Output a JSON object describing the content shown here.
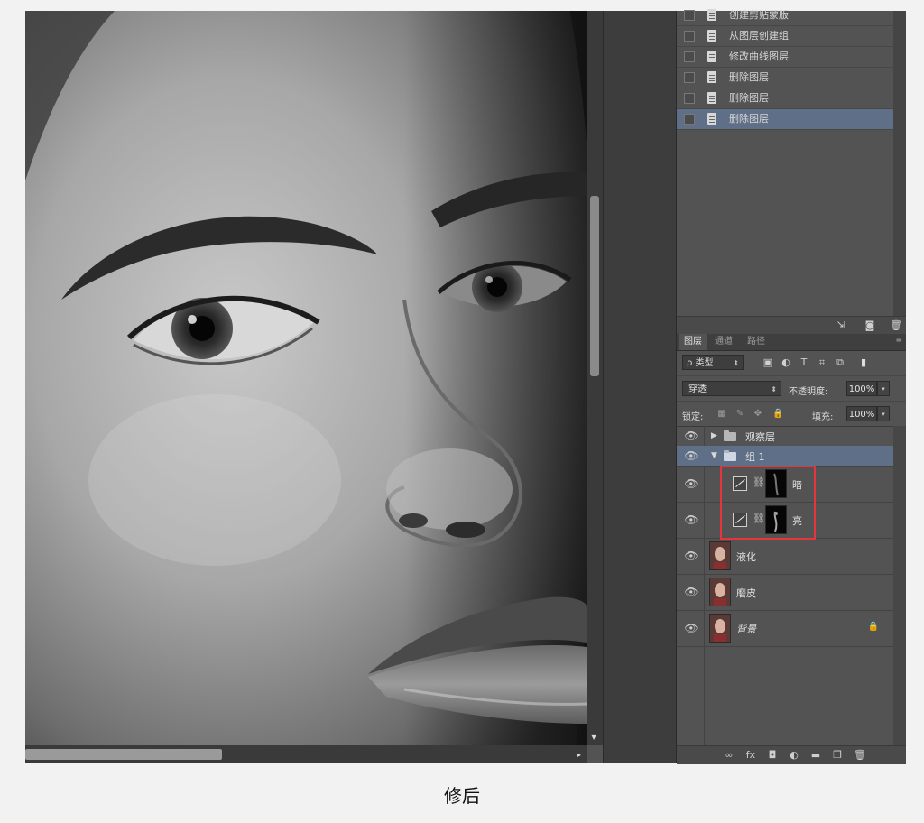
{
  "history": {
    "items": [
      {
        "label": "创建剪贴蒙版",
        "selected": false
      },
      {
        "label": "从图层创建组",
        "selected": false
      },
      {
        "label": "修改曲线图层",
        "selected": false
      },
      {
        "label": "删除图层",
        "selected": false
      },
      {
        "label": "删除图层",
        "selected": false
      },
      {
        "label": "删除图层",
        "selected": true
      }
    ]
  },
  "layers_panel": {
    "tabs": [
      "图层",
      "通道",
      "路径"
    ],
    "filter": {
      "kind_label": "ρ 类型"
    },
    "blend_mode": "穿透",
    "opacity_label": "不透明度:",
    "opacity_value": "100%",
    "lock_label": "锁定:",
    "fill_label": "填充:",
    "fill_value": "100%",
    "layers": [
      {
        "name": "观察层",
        "type": "group",
        "expanded": false,
        "selected": false
      },
      {
        "name": "组 1",
        "type": "group",
        "expanded": true,
        "selected": true
      },
      {
        "name": "暗",
        "type": "curves-adjustment",
        "selected": false
      },
      {
        "name": "亮",
        "type": "curves-adjustment",
        "selected": false
      },
      {
        "name": "液化",
        "type": "pixel",
        "selected": false
      },
      {
        "name": "磨皮",
        "type": "pixel",
        "selected": false
      },
      {
        "name": "背景",
        "type": "pixel",
        "locked": true,
        "selected": false
      }
    ]
  },
  "caption": "修后",
  "colors": {
    "selection": "#5f6f87",
    "highlight_box": "#e6343b",
    "panel_bg": "#535353"
  }
}
